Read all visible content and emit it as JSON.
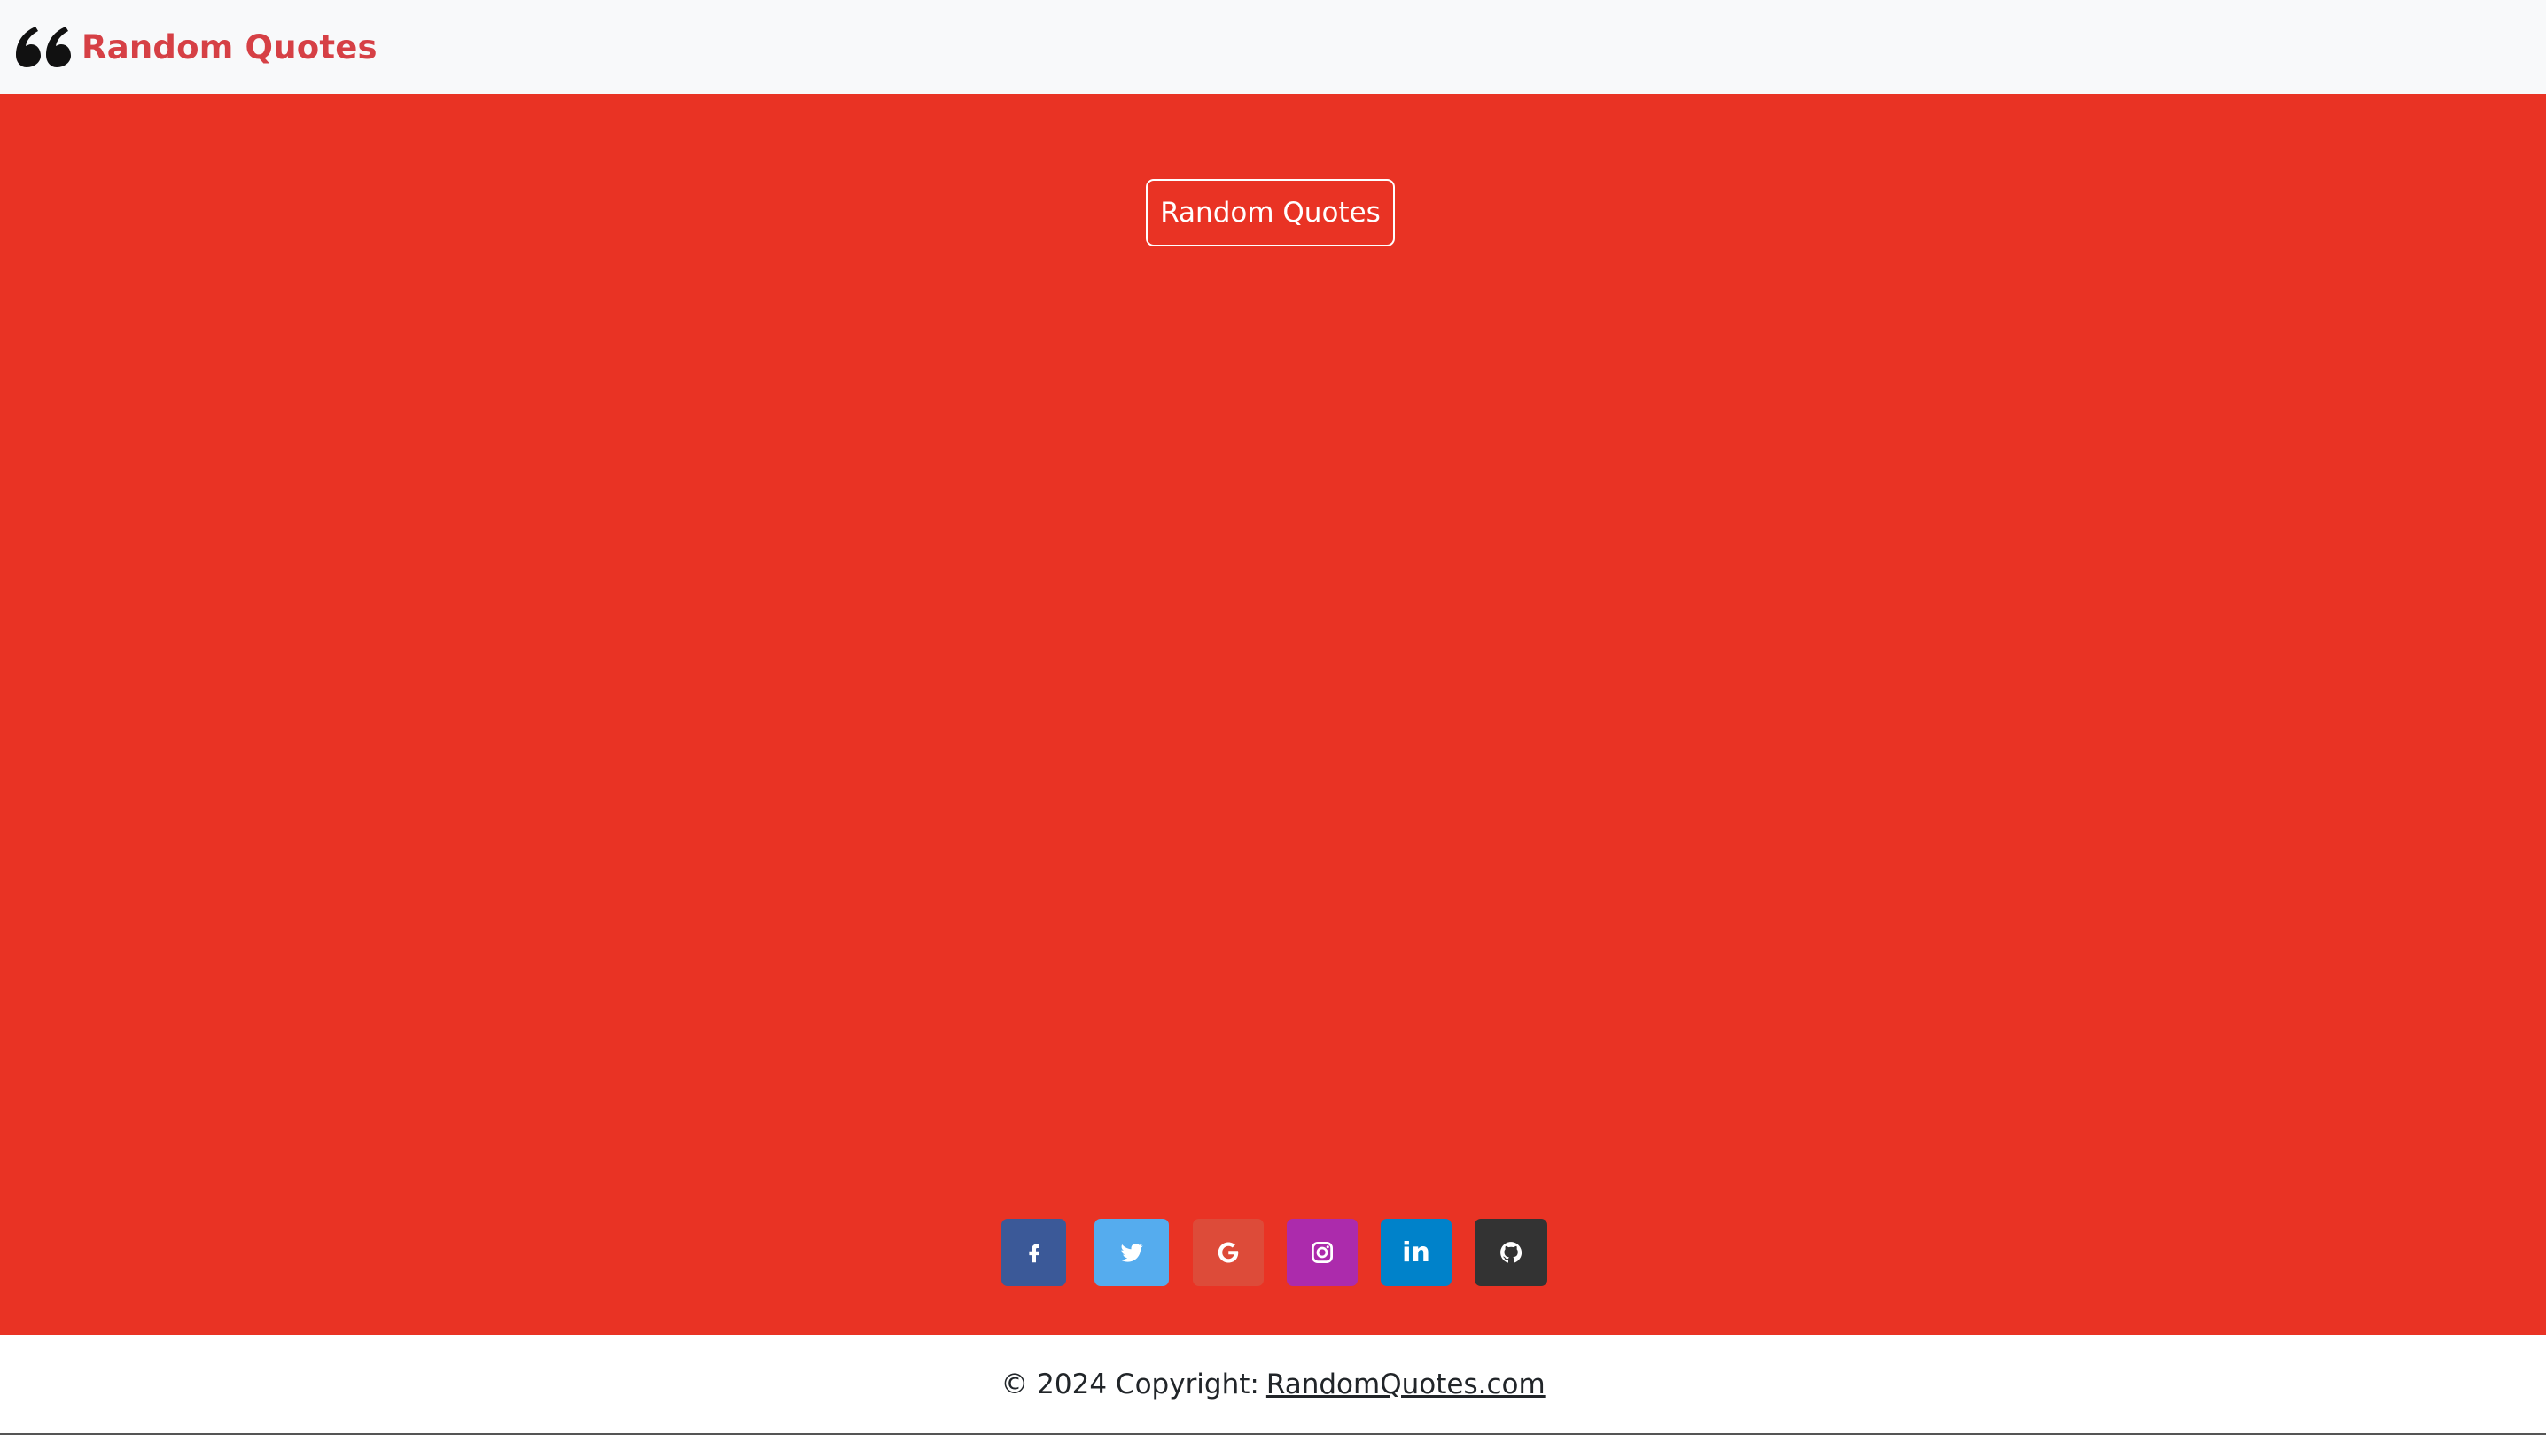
{
  "navbar": {
    "brand_icon": "quote-left-icon",
    "brand_text": "Random Quotes",
    "brand_color": "#d64045"
  },
  "main": {
    "background_color": "#e93324",
    "button_label": "Random Quotes"
  },
  "socials": [
    {
      "name": "facebook",
      "icon": "facebook-icon",
      "color": "#3b5998"
    },
    {
      "name": "twitter",
      "icon": "twitter-icon",
      "color": "#55acee"
    },
    {
      "name": "google",
      "icon": "google-icon",
      "color": "#dd4b39"
    },
    {
      "name": "instagram",
      "icon": "instagram-icon",
      "color": "#ac2bac"
    },
    {
      "name": "linkedin",
      "icon": "linkedin-icon",
      "color": "#0082ca",
      "glyph": "in"
    },
    {
      "name": "github",
      "icon": "github-icon",
      "color": "#333333"
    }
  ],
  "footer": {
    "copyright_prefix": "© 2024 Copyright:",
    "link_text": "RandomQuotes.com"
  }
}
